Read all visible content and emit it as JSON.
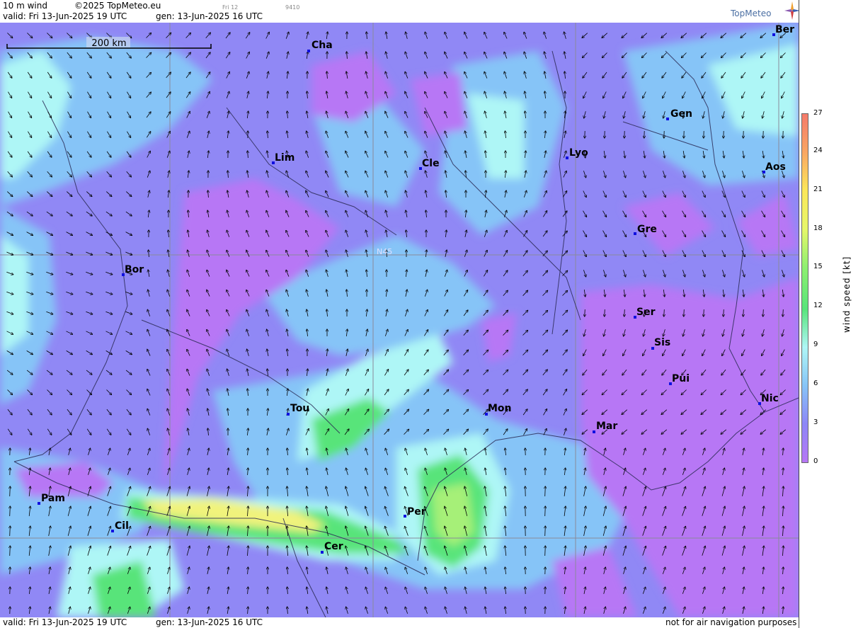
{
  "header": {
    "product": "10 m wind",
    "copyright": "©2025 TopMeteo.eu",
    "day_tag": "Fri 12",
    "code_tag": "9410",
    "valid": "valid:  Fri  13-Jun-2025  19 UTC",
    "generated": "gen: 13-Jun-2025 16 UTC",
    "logo_text": "TopMeteo"
  },
  "map": {
    "scale_label": "200 km",
    "lat_label": "N45",
    "cities": [
      {
        "name": "Cha"
      },
      {
        "name": "Ber"
      },
      {
        "name": "Gen"
      },
      {
        "name": "Lim"
      },
      {
        "name": "Cle"
      },
      {
        "name": "Lyo"
      },
      {
        "name": "Aos"
      },
      {
        "name": "Gre"
      },
      {
        "name": "Bor"
      },
      {
        "name": "Ser"
      },
      {
        "name": "Sis"
      },
      {
        "name": "Pui"
      },
      {
        "name": "Tou"
      },
      {
        "name": "Mon"
      },
      {
        "name": "Nic"
      },
      {
        "name": "Mar"
      },
      {
        "name": "Pam"
      },
      {
        "name": "Per"
      },
      {
        "name": "Cil"
      },
      {
        "name": "Cer"
      }
    ]
  },
  "legend": {
    "ticks": [
      "27",
      "24",
      "21",
      "18",
      "15",
      "12",
      "9",
      "6",
      "3",
      "0"
    ],
    "unit_label": "wind speed [kt]",
    "colors": [
      "#f57a6a",
      "#f9a663",
      "#fbe75a",
      "#e6f76a",
      "#8ef070",
      "#58e47a",
      "#aef6f6",
      "#86c4f7",
      "#8c86f7",
      "#b777f5"
    ]
  },
  "footer": {
    "valid": "valid:  Fri  13-Jun-2025  19 UTC",
    "generated": "gen: 13-Jun-2025 16 UTC",
    "disclaimer": "not for air navigation purposes"
  }
}
